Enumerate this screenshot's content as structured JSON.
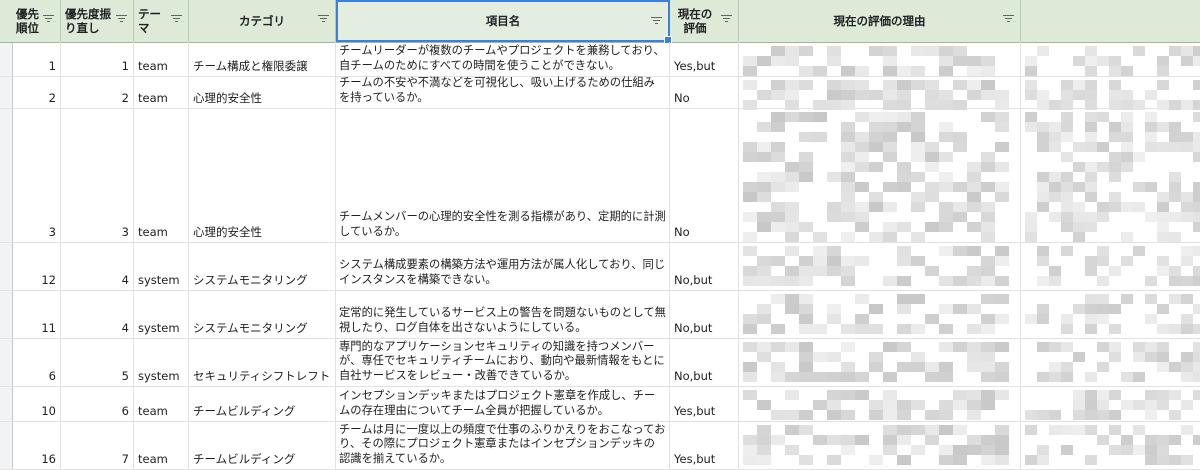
{
  "headers": {
    "priority": "優先\n順位",
    "reassign": "優先度振\nり直し",
    "theme": "テー\nマ",
    "category": "カテゴリ",
    "item": "項目名",
    "evaluation": "現在の\n評価",
    "reason": "現在の評価の理由"
  },
  "rows": [
    {
      "priority": "1",
      "reassign": "1",
      "theme": "team",
      "category": "チーム構成と権限委譲",
      "item": "チームリーダーが複数のチームやプロジェクトを兼務しており、自チームのためにすべての時間を使うことができない。",
      "evaluation": "Yes,but"
    },
    {
      "priority": "2",
      "reassign": "2",
      "theme": "team",
      "category": "心理的安全性",
      "item": "チームの不安や不満などを可視化し、吸い上げるための仕組みを持っているか。",
      "evaluation": "No"
    },
    {
      "priority": "3",
      "reassign": "3",
      "theme": "team",
      "category": "心理的安全性",
      "item": "チームメンバーの心理的安全性を測る指標があり、定期的に計測しているか。",
      "evaluation": "No"
    },
    {
      "priority": "12",
      "reassign": "4",
      "theme": "system",
      "category": "システムモニタリング",
      "item": "システム構成要素の構築方法や運用方法が属人化しており、同じインスタンスを構築できない。",
      "evaluation": "No,but"
    },
    {
      "priority": "11",
      "reassign": "4",
      "theme": "system",
      "category": "システムモニタリング",
      "item": "定常的に発生しているサービス上の警告を問題ないものとして無視したり、ログ自体を出さないようにしている。",
      "evaluation": "No,but"
    },
    {
      "priority": "6",
      "reassign": "5",
      "theme": "system",
      "category": "セキュリティシフトレフト",
      "item": "専門的なアプリケーションセキュリティの知識を持つメンバーが、専任でセキュリティチームにおり、動向や最新情報をもとに自社サービスをレビュー・改善できているか。",
      "evaluation": "No,but"
    },
    {
      "priority": "10",
      "reassign": "6",
      "theme": "team",
      "category": "チームビルディング",
      "item": "インセプションデッキまたはプロジェクト憲章を作成し、チームの存在理由についてチーム全員が把握しているか。",
      "evaluation": "Yes,but"
    },
    {
      "priority": "16",
      "reassign": "7",
      "theme": "team",
      "category": "チームビルディング",
      "item": "チームは月に一度以上の頻度で仕事のふりかえりをおこなっており、その際にプロジェクト憲章またはインセプションデッキの認識を揃えているか。",
      "evaluation": "Yes,but"
    }
  ],
  "colors": {
    "header_bg": "#dcead7",
    "selection": "#3f7fd8",
    "grid": "#e2e2e2"
  },
  "icons": {
    "filter": "filter-icon"
  }
}
